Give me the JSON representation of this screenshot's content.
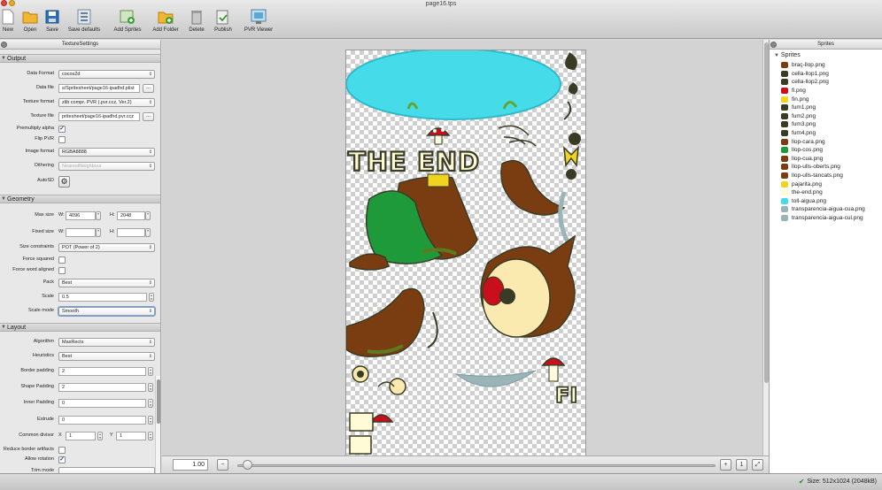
{
  "window": {
    "title": "page16.tps"
  },
  "toolbar": [
    {
      "label": "New",
      "icon": "new-document-icon"
    },
    {
      "label": "Open",
      "icon": "folder-icon"
    },
    {
      "label": "Save",
      "icon": "floppy-disk-icon"
    },
    {
      "label": "Save defaults",
      "icon": "save-defaults-icon"
    },
    {
      "label": "Add Sprites",
      "icon": "add-sprites-icon"
    },
    {
      "label": "Add Folder",
      "icon": "add-folder-icon"
    },
    {
      "label": "Delete",
      "icon": "trash-icon"
    },
    {
      "label": "Publish",
      "icon": "publish-icon"
    },
    {
      "label": "PVR Viewer",
      "icon": "pvr-viewer-icon"
    }
  ],
  "texture_settings": {
    "title": "TextureSettings",
    "output": {
      "header": "Output",
      "data_format_label": "Data Format",
      "data_format": "cocos2d",
      "data_file_label": "Data file",
      "data_file": "s/Spritesheet/page16-ipadhd.plist",
      "texture_format_label": "Texture format",
      "texture_format": "zlib compr. PVR (.pvr.ccz, Ver.2)",
      "texture_file_label": "Texture file",
      "texture_file": "pritesheet/page16-ipadhd.pvr.ccz",
      "premultiply_label": "Premultiply alpha",
      "premultiply_checked": true,
      "flip_pvr_label": "Flip PVR",
      "flip_pvr_checked": false,
      "image_format_label": "Image format",
      "image_format": "RGBA8888",
      "dithering_label": "Dithering",
      "dithering": "NearestNeighbour",
      "autosd_label": "AutoSD",
      "browse_label": "..."
    },
    "geometry": {
      "header": "Geometry",
      "max_size_label": "Max size",
      "w_label": "W:",
      "h_label": "H:",
      "max_w": "4096",
      "max_h": "2048",
      "fixed_size_label": "Fixed size",
      "fixed_w": "",
      "fixed_h": "",
      "size_constraints_label": "Size constraints",
      "size_constraints": "POT (Power of 2)",
      "force_squared_label": "Force squared",
      "force_squared_checked": false,
      "force_word_label": "Force word aligned",
      "force_word_checked": false,
      "pack_label": "Pack",
      "pack": "Best",
      "scale_label": "Scale",
      "scale": "0.5",
      "scale_mode_label": "Scale mode",
      "scale_mode": "Smooth"
    },
    "layout": {
      "header": "Layout",
      "algorithm_label": "Algorithm",
      "algorithm": "MaxRects",
      "heuristics_label": "Heuristics",
      "heuristics": "Best",
      "border_padding_label": "Border padding",
      "border_padding": "2",
      "shape_padding_label": "Shape Padding",
      "shape_padding": "2",
      "inner_padding_label": "Inner Padding",
      "inner_padding": "0",
      "extrude_label": "Extrude",
      "extrude": "0",
      "common_divisor_label": "Common divisor",
      "x_label": "X",
      "y_label": "Y",
      "divisor_x": "1",
      "divisor_y": "1",
      "reduce_border_label": "Reduce border artifacts",
      "reduce_border_checked": false,
      "allow_rotation_label": "Allow rotation",
      "allow_rotation_checked": true,
      "trim_mode_label": "Trim mode"
    }
  },
  "canvas": {
    "text_the_end": "THE END",
    "zoom": "1.00"
  },
  "sprites_panel": {
    "title": "Sprites",
    "root": "Sprites",
    "items": [
      "braç-llop.png",
      "cella-llop1.png",
      "cella-llop2.png",
      "fi.png",
      "fin.png",
      "fum1.png",
      "fum2.png",
      "fum3.png",
      "fum4.png",
      "llop-cara.png",
      "llop-cos.png",
      "llop-cua.png",
      "llop-ulls-oberts.png",
      "llop-ulls-tancats.png",
      "pajarita.png",
      "the-end.png",
      "toll-aigua.png",
      "transparencia-aigua-cua.png",
      "transparencia-aigua-cul.png"
    ]
  },
  "status": {
    "size": "Size: 512x1024 (2048kB)"
  },
  "colors": {
    "water": "#45dbe9",
    "fur": "#7a3d12",
    "pants": "#1f9a3a",
    "mushroom": "#c8101c",
    "accent": "#3b79d8"
  }
}
